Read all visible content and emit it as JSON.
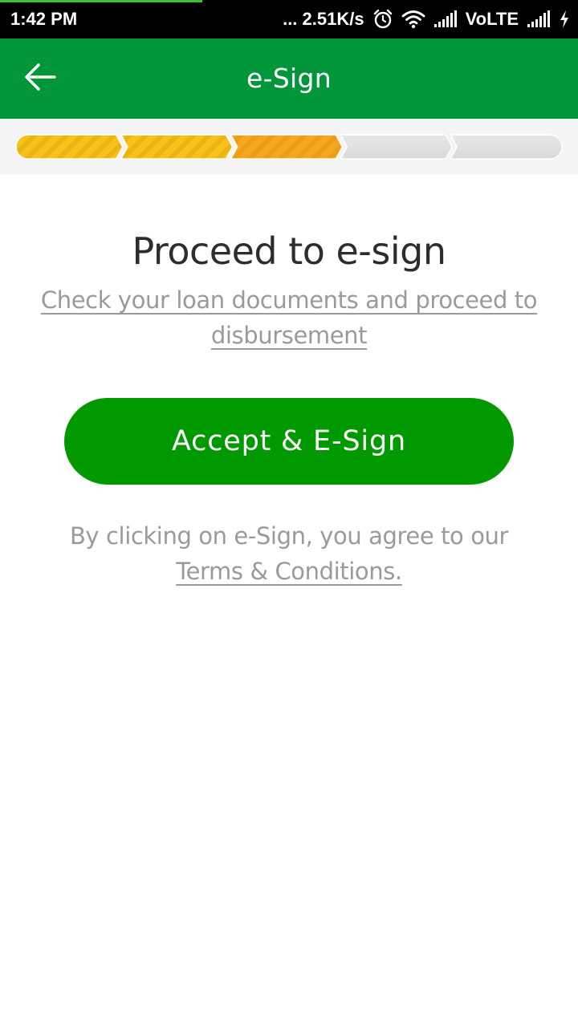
{
  "status_bar": {
    "time": "1:42 PM",
    "net_speed": "... 2.51K/s",
    "network_label": "VoLTE",
    "icons": [
      "alarm-icon",
      "wifi-icon",
      "signal-icon",
      "signal-icon",
      "charging-icon"
    ]
  },
  "app_bar": {
    "title": "e-Sign",
    "back_icon": "arrow-left-icon"
  },
  "stepper": {
    "total_steps": 5,
    "completed_steps": 2,
    "current_step": 3,
    "colors": {
      "completed": "#f8c21a",
      "current": "#f5a81e",
      "pending": "#e1e1e1"
    }
  },
  "main": {
    "heading": "Proceed to e-sign",
    "documents_link": "Check your loan documents and proceed to disbursement",
    "accept_button": "Accept & E-Sign",
    "disclaimer_text": "By clicking on e-Sign, you agree to our",
    "terms_link": "Terms & Conditions."
  },
  "colors": {
    "app_bar": "#009639",
    "button": "#009a00",
    "muted_text": "#9a9a9a"
  }
}
